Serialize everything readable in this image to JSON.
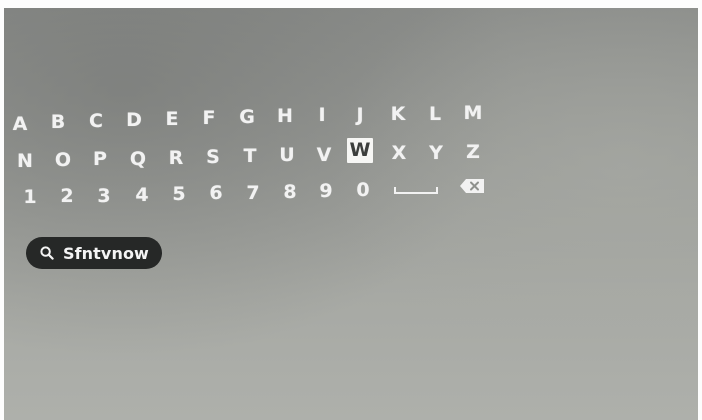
{
  "keyboard": {
    "row1": [
      "A",
      "B",
      "C",
      "D",
      "E",
      "F",
      "G",
      "H",
      "I",
      "J",
      "K",
      "L",
      "M"
    ],
    "row2": [
      "N",
      "O",
      "P",
      "Q",
      "R",
      "S",
      "T",
      "U",
      "V",
      "W",
      "X",
      "Y",
      "Z"
    ],
    "row3": [
      "1",
      "2",
      "3",
      "4",
      "5",
      "6",
      "7",
      "8",
      "9",
      "0"
    ],
    "focused_key": "W",
    "space_icon": "space-bar-icon",
    "backspace_icon": "backspace-icon"
  },
  "search": {
    "icon": "search-icon",
    "query": "Sfntvnow"
  },
  "colors": {
    "key_text": "#f2f2f2",
    "focus_background": "#f6f6f4",
    "pill_background": "#262827"
  }
}
